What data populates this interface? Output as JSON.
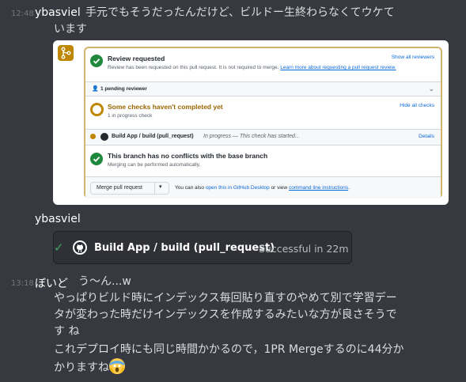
{
  "messages": {
    "m1": {
      "timestamp": "12:48",
      "author": "ybasviel",
      "line1": "手元でもそうだったんだけど、ビルドー生終わらなくてウケて",
      "line2": "います"
    },
    "m2": {
      "author": "ybasviel"
    },
    "m3": {
      "timestamp": "13:18",
      "author": "ぼいど",
      "first": "う〜ん...w",
      "lines": [
        "やっぱりビルド時にインデックス毎回貼り直すのやめて別で学習デー",
        "タが変わった時だけインデックスを作成するみたいな方が良さそうで",
        "す ね",
        "これデプロイ時にも同じ時間かかるので，1PR Mergeするのに44分か",
        "かりますね"
      ]
    }
  },
  "github_card": {
    "review_title": "Review requested",
    "review_sub": "Review has been requested on this pull request. It is not required to merge.",
    "review_learn": "Learn more about requesting a pull request review.",
    "show_all_reviewers": "Show all reviewers",
    "pending_reviewer": "1 pending reviewer",
    "checks_title": "Some checks haven't completed yet",
    "checks_sub": "1 in progress check",
    "hide_all_checks": "Hide all checks",
    "check_name": "Build App / build (pull_request)",
    "check_status": "In progress — This check has started...",
    "details": "Details",
    "conflicts_title": "This branch has no conflicts with the base branch",
    "conflicts_sub": "Merging can be performed automatically.",
    "merge_button": "Merge pull request",
    "also_text": "You can also",
    "open_desktop": "open this in GitHub Desktop",
    "or_view": "or view",
    "cli_instructions": "command line instructions"
  },
  "check_embed": {
    "name": "Build App / build (pull_request)",
    "status": "Successful in 22m"
  },
  "colors": {
    "bg": "#36393f",
    "success": "#1f883d",
    "pending": "#bf8700",
    "link": "#0969da"
  }
}
